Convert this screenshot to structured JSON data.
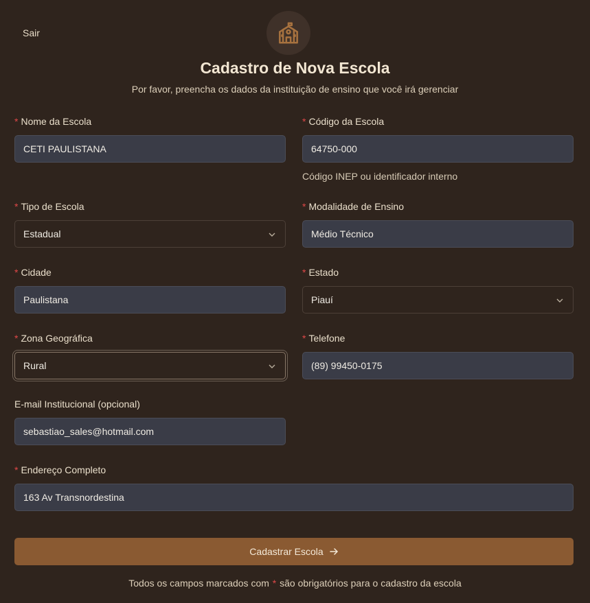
{
  "header": {
    "logout_label": "Sair",
    "logo_icon": "school-icon",
    "title": "Cadastro de Nova Escola",
    "subtitle": "Por favor, preencha os dados da instituição de ensino que você irá gerenciar"
  },
  "form": {
    "required_marker": "*",
    "nome": {
      "label": "Nome da Escola",
      "value": "CETI PAULISTANA"
    },
    "codigo": {
      "label": "Código da Escola",
      "value": "64750-000",
      "hint": "Código INEP ou identificador interno"
    },
    "tipo": {
      "label": "Tipo de Escola",
      "value": "Estadual"
    },
    "modalidade": {
      "label": "Modalidade de Ensino",
      "value": "Médio Técnico"
    },
    "cidade": {
      "label": "Cidade",
      "value": "Paulistana"
    },
    "estado": {
      "label": "Estado",
      "value": "Piauí"
    },
    "zona": {
      "label": "Zona Geográfica",
      "value": "Rural"
    },
    "telefone": {
      "label": "Telefone",
      "value": "(89) 99450-0175"
    },
    "email": {
      "label": "E-mail Institucional (opcional)",
      "value": "sebastiao_sales@hotmail.com"
    },
    "endereco": {
      "label": "Endereço Completo",
      "value": "163 Av Transnordestina"
    },
    "submit_label": "Cadastrar Escola"
  },
  "footer": {
    "before": "Todos os campos marcados com",
    "marker": "*",
    "after": "são obrigatórios para o cadastro da escola"
  },
  "colors": {
    "background": "#2f241d",
    "input_bg": "#3a3c47",
    "accent": "#8a5a32",
    "required": "#e04848"
  }
}
